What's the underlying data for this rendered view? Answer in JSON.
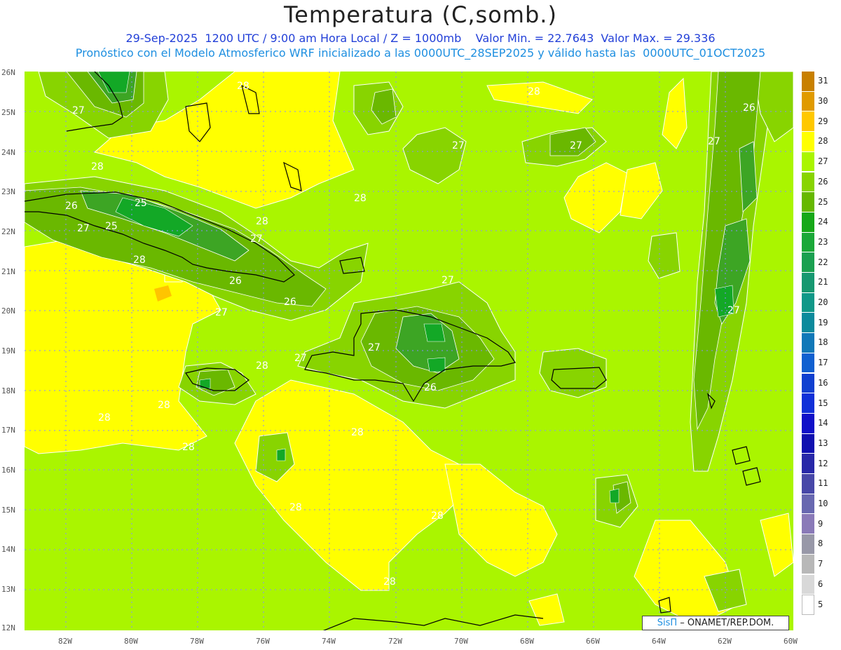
{
  "header": {
    "title": "Temperatura (C,somb.)",
    "line1": "29-Sep-2025  1200 UTC / 9:00 am Hora Local / Z = 1000mb    Valor Min. = 22.7643  Valor Max. = 29.336",
    "line2": "Pronóstico con el Modelo Atmosferico WRF inicializado a las 0000UTC_28SEP2025 y válido hasta las  0000UTC_01OCT2025"
  },
  "map": {
    "lat_labels": [
      "26N",
      "25N",
      "24N",
      "23N",
      "22N",
      "21N",
      "20N",
      "19N",
      "18N",
      "17N",
      "16N",
      "15N",
      "14N",
      "13N",
      "12N"
    ],
    "lon_labels": [
      "82W",
      "80W",
      "78W",
      "76W",
      "74W",
      "72W",
      "70W",
      "68W",
      "66W",
      "64W",
      "62W",
      "60W"
    ],
    "contour_labels": [
      "28",
      "27",
      "28",
      "28",
      "27",
      "28",
      "27",
      "26",
      "25",
      "27",
      "25",
      "28",
      "27",
      "26",
      "26",
      "27",
      "27",
      "28",
      "28",
      "28",
      "27",
      "26",
      "27",
      "27",
      "27",
      "28",
      "28",
      "28",
      "28",
      "28",
      "28",
      "26"
    ],
    "colors": {
      "background": "#aaf500",
      "level_27": "#88d400",
      "level_26": "#6ab800",
      "level_25": "#3da524",
      "level_24": "#13a826",
      "level_28": "#ffff00",
      "level_29": "#ffc400",
      "coast": "#000000",
      "grid": "#8a8aff"
    }
  },
  "colorbar": {
    "levels": [
      "31",
      "30",
      "29",
      "28",
      "27",
      "26",
      "25",
      "24",
      "23",
      "22",
      "21",
      "20",
      "19",
      "18",
      "17",
      "16",
      "15",
      "14",
      "13",
      "12",
      "11",
      "10",
      "9",
      "8",
      "7",
      "6",
      "5"
    ],
    "colors": [
      "#c88000",
      "#e09a00",
      "#ffc800",
      "#ffff00",
      "#aaf500",
      "#88d400",
      "#66b800",
      "#16a818",
      "#1aa838",
      "#1aa050",
      "#169870",
      "#109888",
      "#0c8a9c",
      "#1078b8",
      "#1060d0",
      "#1040d0",
      "#1030d8",
      "#1010c8",
      "#1010b0",
      "#2828a8",
      "#4848a8",
      "#6868b0",
      "#8a7ab8",
      "#9898a8",
      "#b8b8b8",
      "#d8d8d8",
      "#ffffff"
    ]
  },
  "footer": {
    "brand": "SisΠ",
    "credit": "– ONAMET/REP.DOM."
  }
}
